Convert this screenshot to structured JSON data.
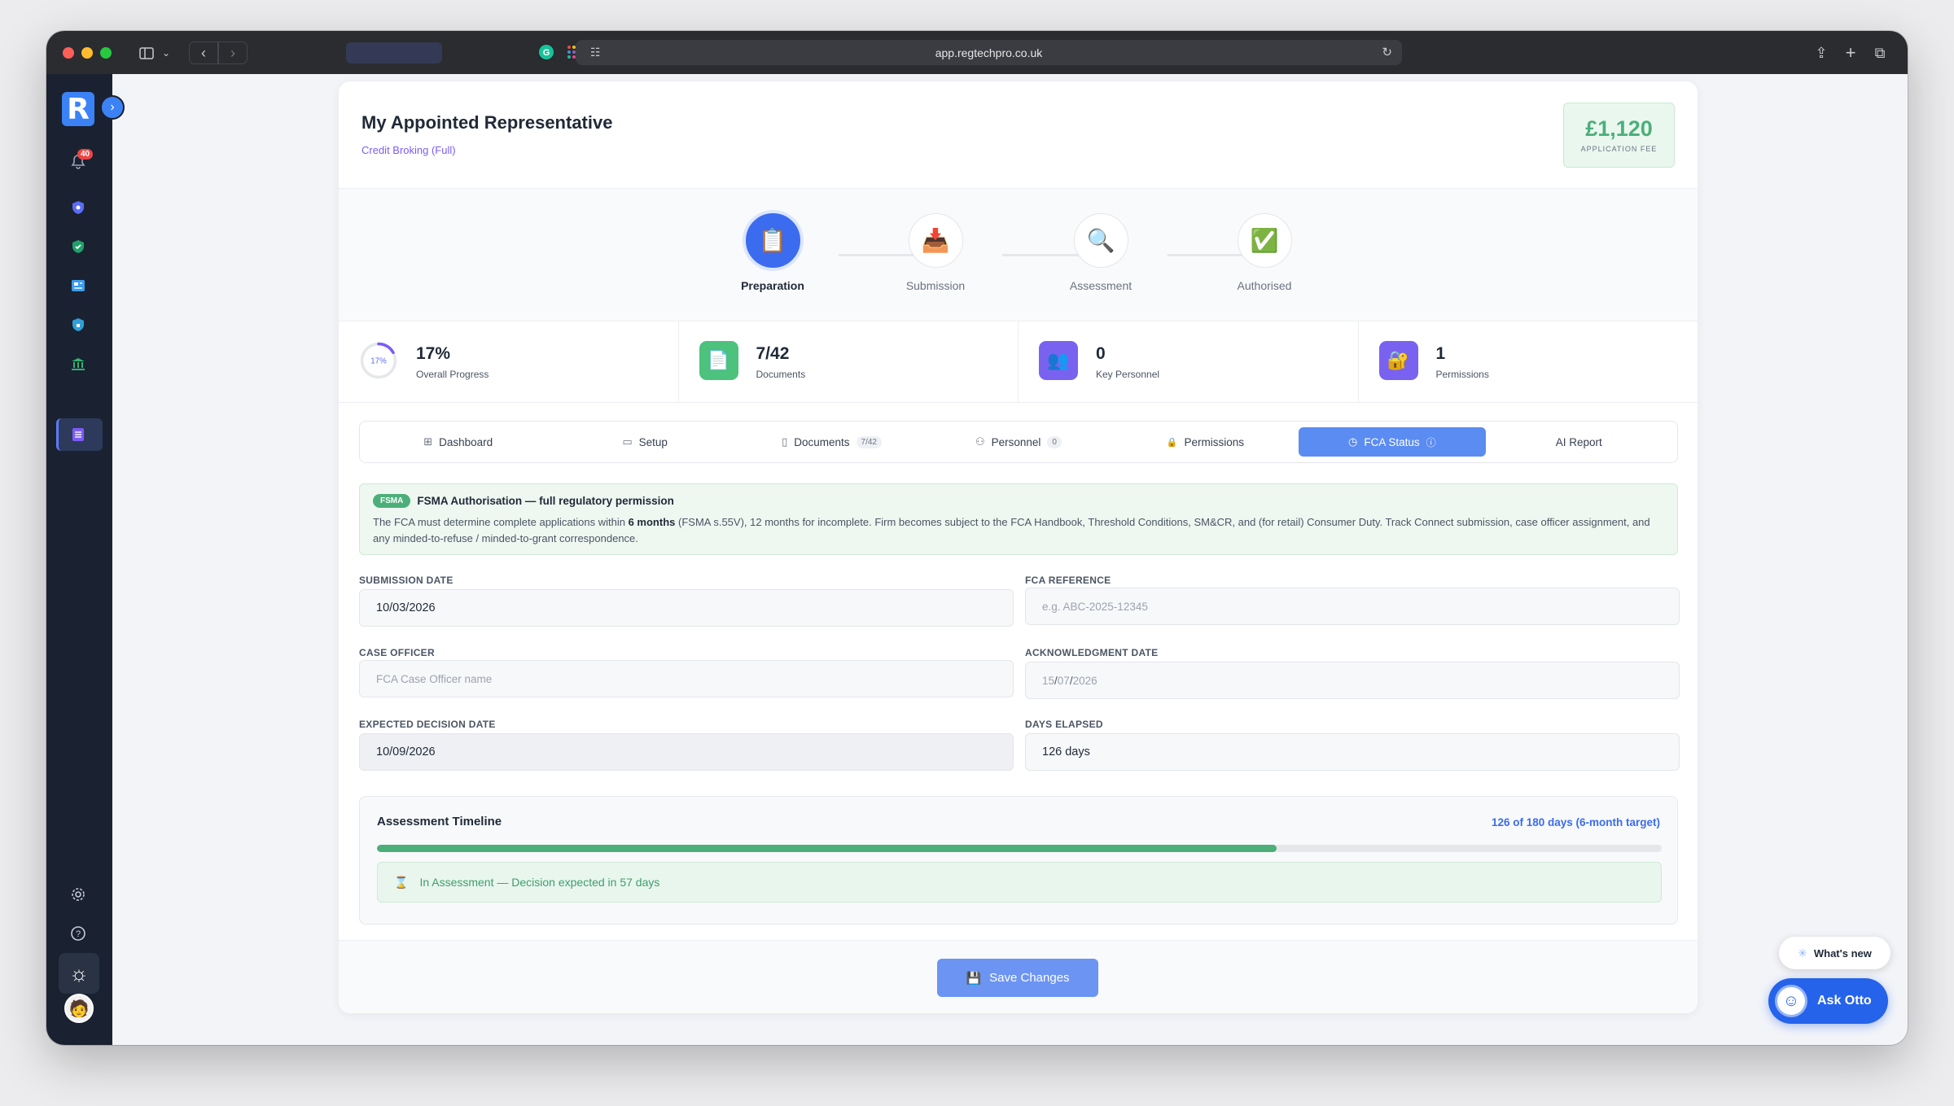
{
  "browser": {
    "url": "app.regtechpro.co.uk"
  },
  "sidebar": {
    "logo": "R",
    "notification_count": "40",
    "items": [
      {
        "icon": "bell-icon"
      },
      {
        "icon": "shield-icon"
      },
      {
        "icon": "shield-check-icon"
      },
      {
        "icon": "news-icon"
      },
      {
        "icon": "shield-lock-icon"
      },
      {
        "icon": "bank-icon"
      },
      {
        "icon": "clipboard-list-icon"
      }
    ]
  },
  "header": {
    "title": "My Appointed Representative",
    "subtitle": "Credit Broking (Full)",
    "fee_amount": "£1,120",
    "fee_label": "APPLICATION FEE"
  },
  "steps": [
    {
      "label": "Preparation",
      "icon": "📋",
      "active": true
    },
    {
      "label": "Submission",
      "icon": "📥",
      "active": false
    },
    {
      "label": "Assessment",
      "icon": "🔍",
      "active": false
    },
    {
      "label": "Authorised",
      "icon": "✅",
      "active": false
    }
  ],
  "stats": [
    {
      "value": "17%",
      "label": "Overall Progress",
      "ring_text": "17%",
      "progress": 0.17
    },
    {
      "value": "7/42",
      "label": "Documents",
      "icon": "📄"
    },
    {
      "value": "0",
      "label": "Key Personnel",
      "icon": "👥"
    },
    {
      "value": "1",
      "label": "Permissions",
      "icon": "🔐"
    }
  ],
  "tabs": [
    {
      "label": "Dashboard",
      "icon": "⊞",
      "count": ""
    },
    {
      "label": "Setup",
      "icon": "▭",
      "count": ""
    },
    {
      "label": "Documents",
      "icon": "▯",
      "count": "7/42"
    },
    {
      "label": "Personnel",
      "icon": "⚇",
      "count": "0"
    },
    {
      "label": "Permissions",
      "icon": "🔒",
      "count": ""
    },
    {
      "label": "FCA Status",
      "icon": "◷",
      "count": "",
      "active": true
    },
    {
      "label": "AI Report",
      "icon": "",
      "count": ""
    }
  ],
  "info": {
    "tag": "FSMA",
    "title": "FSMA Authorisation — full regulatory permission",
    "body_before": "The FCA must determine complete applications within ",
    "body_bold": "6 months",
    "body_after": " (FSMA s.55V), 12 months for incomplete. Firm becomes subject to the FCA Handbook, Threshold Conditions, SM&CR, and (for retail) Consumer Duty. Track Connect submission, case officer assignment, and any minded-to-refuse / minded-to-grant correspondence."
  },
  "form": {
    "submission_date": {
      "label": "SUBMISSION DATE",
      "value": "10/03/2026"
    },
    "fca_reference": {
      "label": "FCA REFERENCE",
      "placeholder": "e.g. ABC-2025-12345"
    },
    "case_officer": {
      "label": "CASE OFFICER",
      "placeholder": "FCA Case Officer name"
    },
    "acknowledgment_date": {
      "label": "ACKNOWLEDGMENT DATE",
      "dd": "15",
      "mm": "07",
      "yyyy": "2026"
    },
    "expected_decision_date": {
      "label": "EXPECTED DECISION DATE",
      "value": "10/09/2026"
    },
    "days_elapsed": {
      "label": "DAYS ELAPSED",
      "value": "126 days"
    }
  },
  "timeline": {
    "title": "Assessment Timeline",
    "summary": "126 of 180 days (6-month target)",
    "progress": 0.7,
    "status": "In Assessment — Decision expected in 57 days",
    "status_icon": "⌛"
  },
  "footer": {
    "save_label": "Save Changes",
    "save_icon": "💾"
  },
  "widgets": {
    "whats_new": "What's new",
    "ask_otto": "Ask Otto"
  },
  "colors": {
    "primary": "#3b6cf0",
    "success": "#4caf7a",
    "sidebar": "#1a2130",
    "accent_purple": "#7c5cf6"
  }
}
